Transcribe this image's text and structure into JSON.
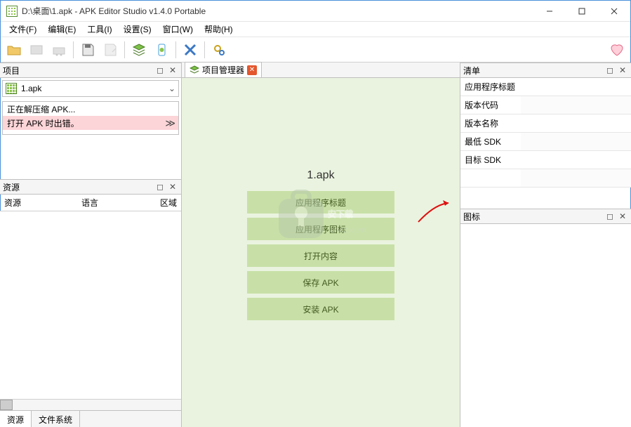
{
  "window": {
    "title": "D:\\桌面\\1.apk  - APK Editor Studio v1.4.0 Portable"
  },
  "menu": {
    "file": "文件(F)",
    "edit": "编辑(E)",
    "tools": "工具(I)",
    "settings": "设置(S)",
    "window": "窗口(W)",
    "help": "帮助(H)"
  },
  "panels": {
    "project": "项目",
    "resources": "资源",
    "manifest": "清单",
    "icons": "图标",
    "projectManager": "项目管理器"
  },
  "project": {
    "current": "1.apk",
    "messages": {
      "decompressing": "正在解压缩 APK...",
      "error": "打开 APK 时出错。"
    }
  },
  "resources": {
    "col_res": "资源",
    "col_lang": "语言",
    "col_region": "区域",
    "tabs": {
      "res": "资源",
      "fs": "文件系统"
    }
  },
  "center": {
    "apkName": "1.apk",
    "buttons": {
      "appTitle": "应用程序标题",
      "appIcon": "应用程序图标",
      "openContent": "打开内容",
      "saveApk": "保存 APK",
      "installApk": "安装 APK"
    }
  },
  "manifest": {
    "rows": {
      "appTitle": "应用程序标题",
      "versionCode": "版本代码",
      "versionName": "版本名称",
      "minSdk": "最低 SDK",
      "targetSdk": "目标 SDK"
    }
  }
}
